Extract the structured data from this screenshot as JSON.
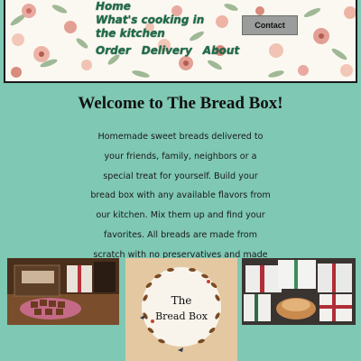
{
  "nav": {
    "home": "Home",
    "cooking": "What's cooking in the kitchen",
    "order": "Order",
    "delivery": "Delivery",
    "about": "About",
    "contact": "Contact"
  },
  "main": {
    "title": "Welcome to The Bread Box!",
    "intro": "Homemade sweet breads delivered to your friends, family, neighbors or a special treat for yourself. Build your bread box with any available flavors from our kitchen. Mix them up and find your favorites. All breads are made from scratch with no preservatives and made with love."
  },
  "logo": {
    "line1": "The",
    "line2": "Bread Box"
  },
  "colors": {
    "page_background": "#7fc8b3",
    "header_background": "#fbf8f1",
    "nav_text": "#1e6b49",
    "contact_button": "#9a9d9b"
  },
  "icons": [
    "flower-decoration-icon",
    "heart-icon",
    "leaf-wreath-icon",
    "bird-icon"
  ]
}
